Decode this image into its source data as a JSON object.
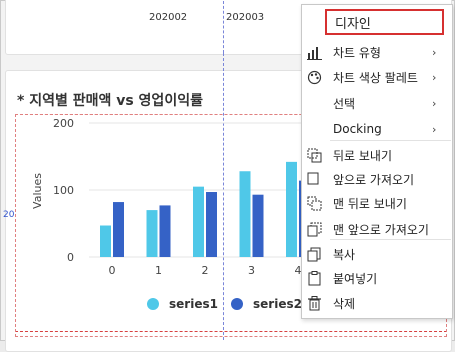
{
  "colors": {
    "series1": "#4fc8e8",
    "series2": "#3562c6",
    "highlight": "#d63030"
  },
  "top_chart": {
    "ticks": [
      "202002",
      "202003"
    ]
  },
  "chart_data": {
    "type": "bar",
    "title": "* 지역별 판매액 vs 영업이익률",
    "categories": [
      "0",
      "1",
      "2",
      "3",
      "4"
    ],
    "series": [
      {
        "name": "series1",
        "values": [
          47,
          70,
          105,
          128,
          142
        ]
      },
      {
        "name": "series2",
        "values": [
          82,
          77,
          97,
          93,
          114
        ]
      }
    ],
    "ylabel": "Values",
    "xlabel": "",
    "ylim": [
      0,
      200
    ],
    "yticks": [
      "0",
      "100",
      "200"
    ],
    "grid": true,
    "legend": "bottom"
  },
  "side_label": "20",
  "context_menu": {
    "header": "디자인",
    "items": [
      {
        "label": "차트 유형",
        "icon": "bar-chart-icon",
        "submenu": true
      },
      {
        "label": "차트 색상 팔레트",
        "icon": "palette-icon",
        "submenu": true
      },
      {
        "label": "선택",
        "icon": "",
        "submenu": true
      },
      {
        "label": "Docking",
        "icon": "",
        "submenu": true
      },
      {
        "label": "뒤로 보내기",
        "icon": "send-backward-icon",
        "submenu": false
      },
      {
        "label": "앞으로 가져오기",
        "icon": "bring-forward-icon",
        "submenu": false
      },
      {
        "label": "맨 뒤로 보내기",
        "icon": "send-to-back-icon",
        "submenu": false
      },
      {
        "label": "맨 앞으로 가져오기",
        "icon": "bring-to-front-icon",
        "submenu": false
      },
      {
        "label": "복사",
        "icon": "copy-icon",
        "submenu": false
      },
      {
        "label": "붙여넣기",
        "icon": "paste-icon",
        "submenu": false
      },
      {
        "label": "삭제",
        "icon": "trash-icon",
        "submenu": false
      }
    ],
    "submenu_arrow": "›"
  }
}
